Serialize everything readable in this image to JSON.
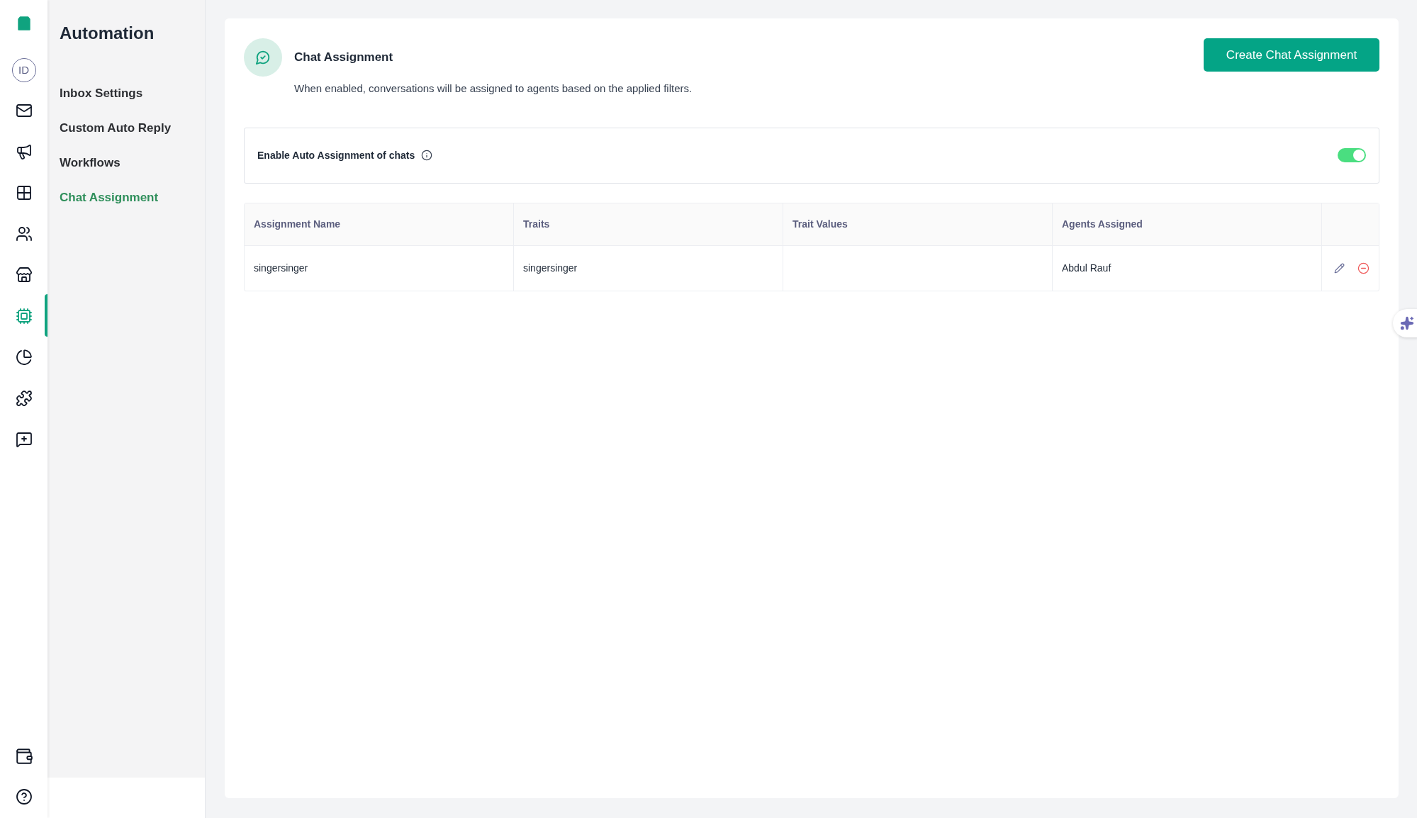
{
  "rail": {
    "avatar": "ID",
    "items": [
      {
        "selected": false
      },
      {
        "selected": false
      },
      {
        "selected": false
      },
      {
        "selected": false
      },
      {
        "selected": false
      },
      {
        "selected": true
      },
      {
        "selected": false
      },
      {
        "selected": false
      },
      {
        "selected": false
      }
    ]
  },
  "sidebar": {
    "title": "Automation",
    "items": [
      {
        "label": "Inbox Settings",
        "selected": false
      },
      {
        "label": "Custom Auto Reply",
        "selected": false
      },
      {
        "label": "Workflows",
        "selected": false
      },
      {
        "label": "Chat Assignment",
        "selected": true
      }
    ]
  },
  "header": {
    "title": "Chat Assignment",
    "description": "When enabled, conversations will be assigned to agents based on the applied filters.",
    "button": "Create Chat Assignment"
  },
  "auto_assign": {
    "label": "Enable Auto Assignment of chats",
    "on": true
  },
  "table": {
    "columns": [
      "Assignment Name",
      "Traits",
      "Trait Values",
      "Agents Assigned"
    ],
    "rows": [
      {
        "cells": [
          "singersinger",
          "singersinger",
          null,
          "Abdul Rauf"
        ]
      }
    ]
  }
}
